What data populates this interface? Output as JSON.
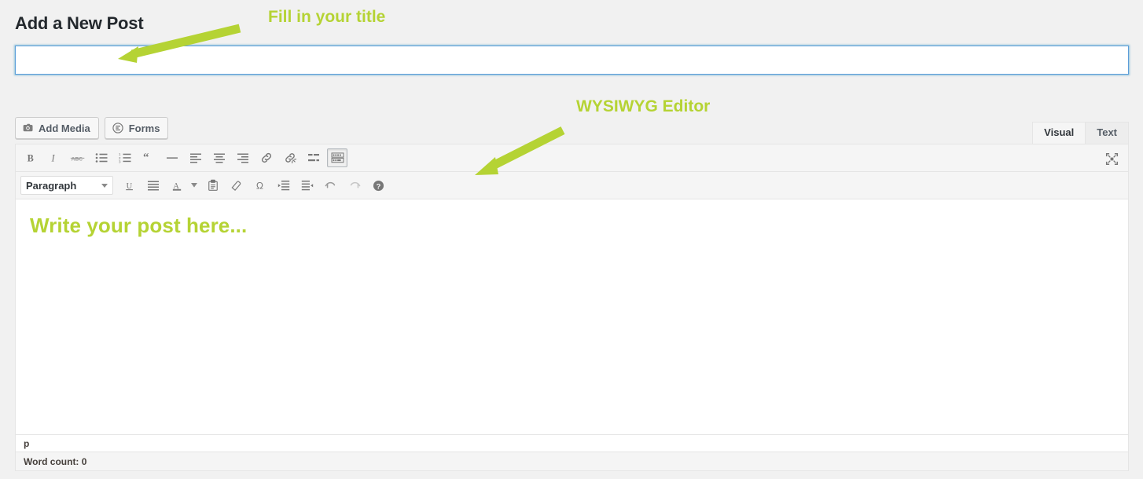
{
  "page": {
    "heading": "Add a New Post",
    "background_color": "#f1f1f1",
    "accent_color": "#b5d334",
    "focus_border_color": "#5b9dd9"
  },
  "title_field": {
    "value": "",
    "placeholder": "",
    "name": "post-title"
  },
  "media_buttons": [
    {
      "label": "Add Media",
      "icon": "camera-icon"
    },
    {
      "label": "Forms",
      "icon": "forms-icon"
    }
  ],
  "editor_tabs": [
    {
      "label": "Visual",
      "active": true
    },
    {
      "label": "Text",
      "active": false
    }
  ],
  "toolbar_row1": [
    {
      "name": "bold",
      "glyph": "B"
    },
    {
      "name": "italic",
      "glyph": "I"
    },
    {
      "name": "strikethrough",
      "glyph": "ABC"
    },
    {
      "name": "bullet-list",
      "glyph": ""
    },
    {
      "name": "numbered-list",
      "glyph": ""
    },
    {
      "name": "blockquote",
      "glyph": "“"
    },
    {
      "name": "horizontal-rule",
      "glyph": "—"
    },
    {
      "name": "align-left",
      "glyph": ""
    },
    {
      "name": "align-center",
      "glyph": ""
    },
    {
      "name": "align-right",
      "glyph": ""
    },
    {
      "name": "insert-link",
      "glyph": ""
    },
    {
      "name": "remove-link",
      "glyph": ""
    },
    {
      "name": "read-more",
      "glyph": ""
    },
    {
      "name": "kitchen-sink",
      "glyph": "",
      "active": true
    }
  ],
  "toolbar_row2": {
    "format_select": {
      "value": "Paragraph"
    },
    "buttons": [
      {
        "name": "underline"
      },
      {
        "name": "justify"
      },
      {
        "name": "text-color"
      },
      {
        "name": "paste-as-text"
      },
      {
        "name": "clear-formatting"
      },
      {
        "name": "special-character",
        "glyph": "Ω"
      },
      {
        "name": "outdent"
      },
      {
        "name": "indent"
      },
      {
        "name": "undo"
      },
      {
        "name": "redo"
      },
      {
        "name": "keyboard-shortcuts"
      }
    ]
  },
  "fullscreen_button": {
    "name": "distraction-free-writing"
  },
  "editor_body": {
    "placeholder": "Write your post here..."
  },
  "status_bar": {
    "path": "p",
    "word_count": "Word count: 0"
  },
  "annotations": [
    {
      "text": "Fill in your title",
      "target": "title-field"
    },
    {
      "text": "WYSIWYG Editor",
      "target": "editor-toolbar"
    }
  ]
}
